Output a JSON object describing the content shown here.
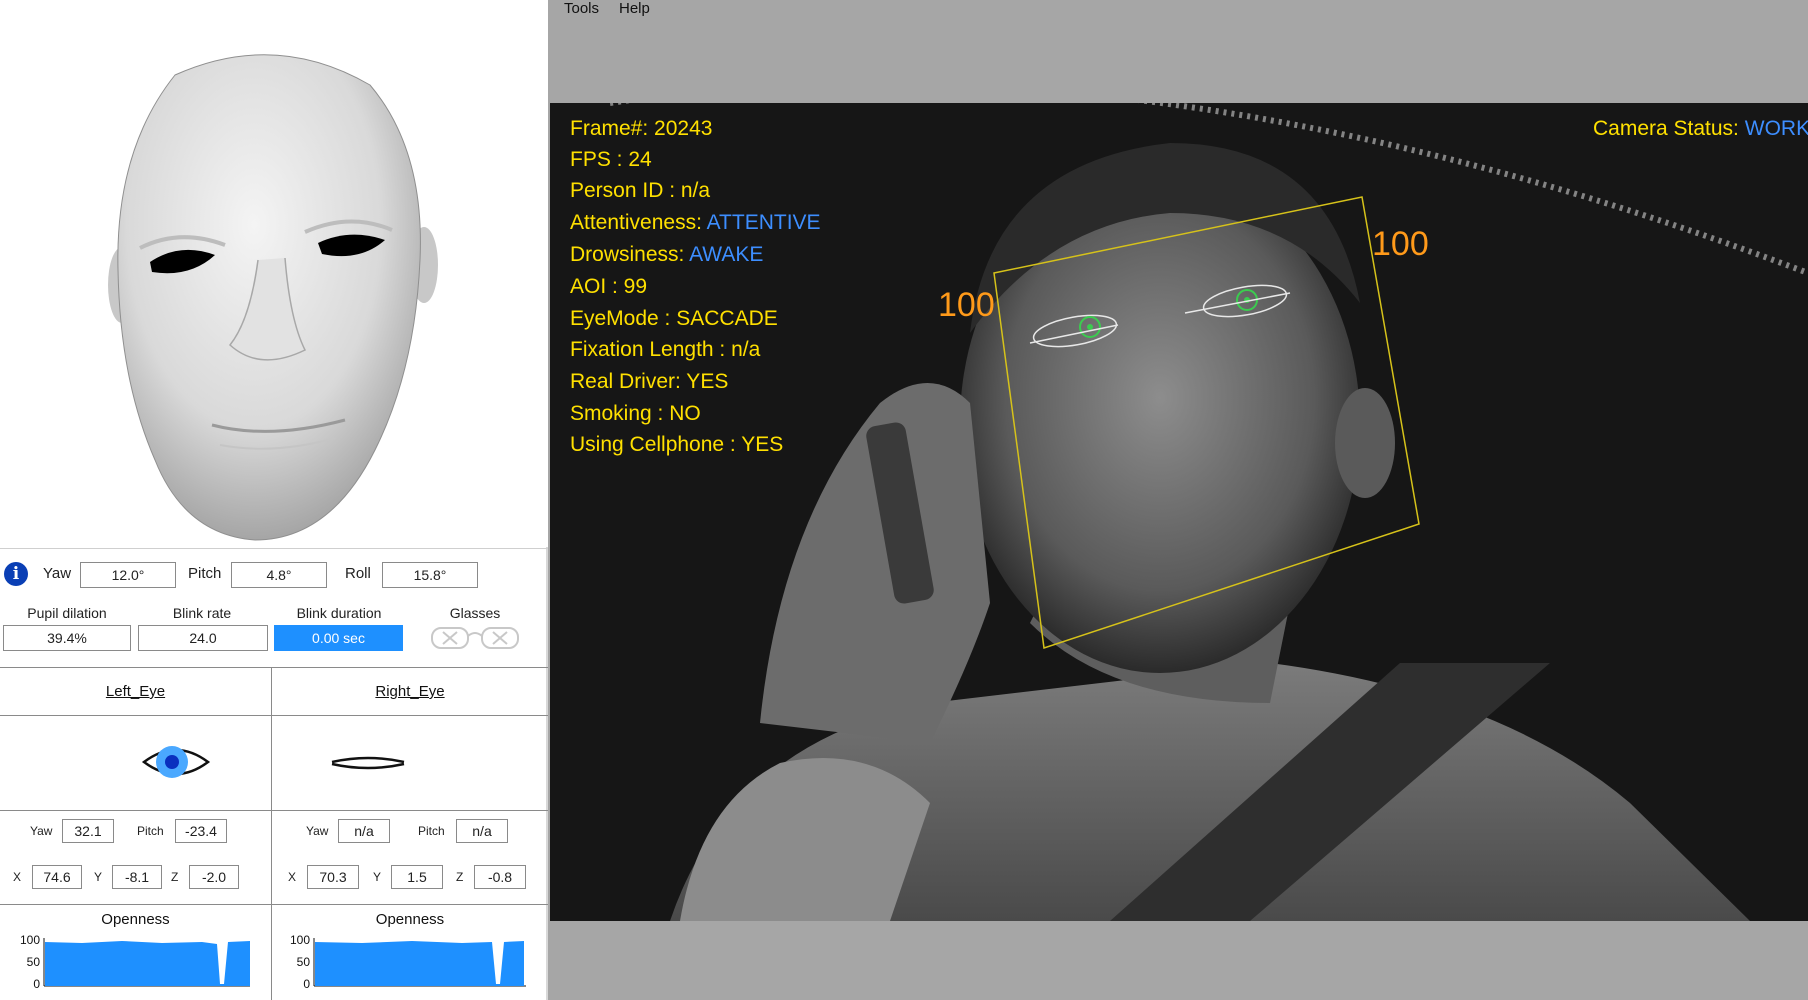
{
  "menu": {
    "tools": "Tools",
    "help": "Help"
  },
  "head_pose": {
    "yaw_label": "Yaw",
    "yaw": "12.0°",
    "pitch_label": "Pitch",
    "pitch": "4.8°",
    "roll_label": "Roll",
    "roll": "15.8°"
  },
  "metrics": {
    "pupil_label": "Pupil dilation",
    "pupil": "39.4%",
    "blink_rate_label": "Blink rate",
    "blink_rate": "24.0",
    "blink_duration_label": "Blink duration",
    "blink_duration": "0.00 sec",
    "glasses_label": "Glasses"
  },
  "left_eye": {
    "title": "Left_Eye",
    "yaw_label": "Yaw",
    "yaw": "32.1",
    "pitch_label": "Pitch",
    "pitch": "-23.4",
    "x_label": "X",
    "x": "74.6",
    "y_label": "Y",
    "y": "-8.1",
    "z_label": "Z",
    "z": "-2.0",
    "openness_label": "Openness"
  },
  "right_eye": {
    "title": "Right_Eye",
    "yaw_label": "Yaw",
    "yaw": "n/a",
    "pitch_label": "Pitch",
    "pitch": "n/a",
    "x_label": "X",
    "x": "70.3",
    "y_label": "Y",
    "y": "1.5",
    "z_label": "Z",
    "z": "-0.8",
    "openness_label": "Openness"
  },
  "openness_axis": {
    "t100": "100",
    "t50": "50",
    "t0": "0"
  },
  "overlay": {
    "frame_label": "Frame#:",
    "frame": "20243",
    "fps_label": "FPS :",
    "fps": "24",
    "person_id": "Person ID : n/a",
    "attentiveness_label": "Attentiveness:",
    "attentiveness": "ATTENTIVE",
    "drowsiness_label": "Drowsiness:",
    "drowsiness": "AWAKE",
    "aoi": "AOI : 99",
    "eyemode": "EyeMode : SACCADE",
    "fixation": "Fixation Length : n/a",
    "real_driver": "Real Driver: YES",
    "smoking": "Smoking : NO",
    "cellphone": "Using Cellphone : YES",
    "camera_status_label": "Camera Status:",
    "camera_status": "WORK",
    "score_left": "100",
    "score_right": "100"
  },
  "colors": {
    "overlay_text": "#ffe000",
    "status_blue": "#3d8eff",
    "score_orange": "#ff9a1a",
    "accent_blue": "#1e90ff"
  }
}
